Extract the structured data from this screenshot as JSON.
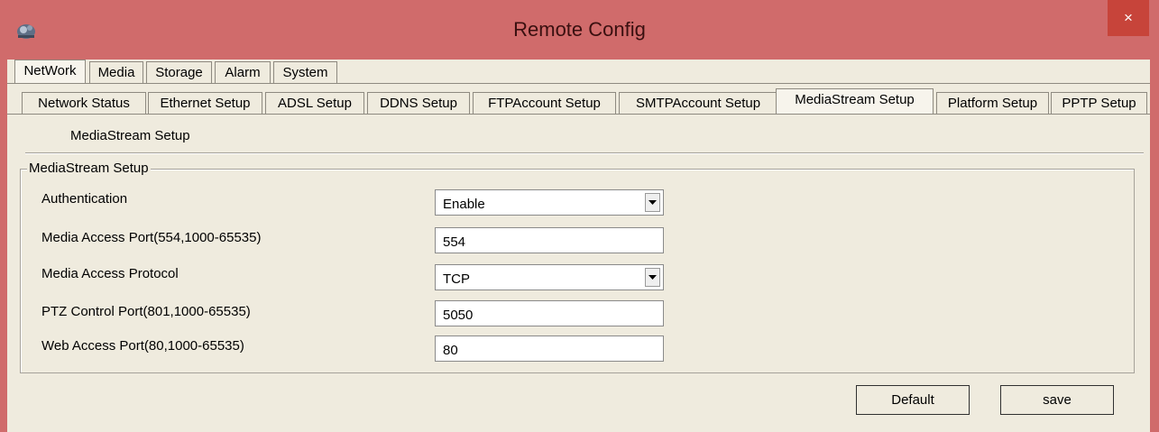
{
  "window": {
    "title": "Remote Config",
    "close_glyph": "×",
    "accent": "#d06b6b",
    "close_color": "#c7443a"
  },
  "main_tabs": [
    "NetWork",
    "Media",
    "Storage",
    "Alarm",
    "System"
  ],
  "sub_tabs": [
    "Network Status",
    "Ethernet Setup",
    "ADSL Setup",
    "DDNS Setup",
    "FTPAccount Setup",
    "SMTPAccount Setup",
    "MediaStream Setup",
    "Platform Setup",
    "PPTP Setup"
  ],
  "section_title": "MediaStream Setup",
  "group": {
    "legend": "MediaStream Setup",
    "rows": [
      {
        "label": "Authentication",
        "value": "Enable",
        "type": "select"
      },
      {
        "label": "Media Access Port(554,1000-65535)",
        "value": "554",
        "type": "text"
      },
      {
        "label": "Media Access Protocol",
        "value": "TCP",
        "type": "select"
      },
      {
        "label": "PTZ Control Port(801,1000-65535)",
        "value": "5050",
        "type": "text"
      },
      {
        "label": "Web Access Port(80,1000-65535)",
        "value": "80",
        "type": "text"
      }
    ]
  },
  "buttons": {
    "default_label": "Default",
    "save_label": "save"
  }
}
